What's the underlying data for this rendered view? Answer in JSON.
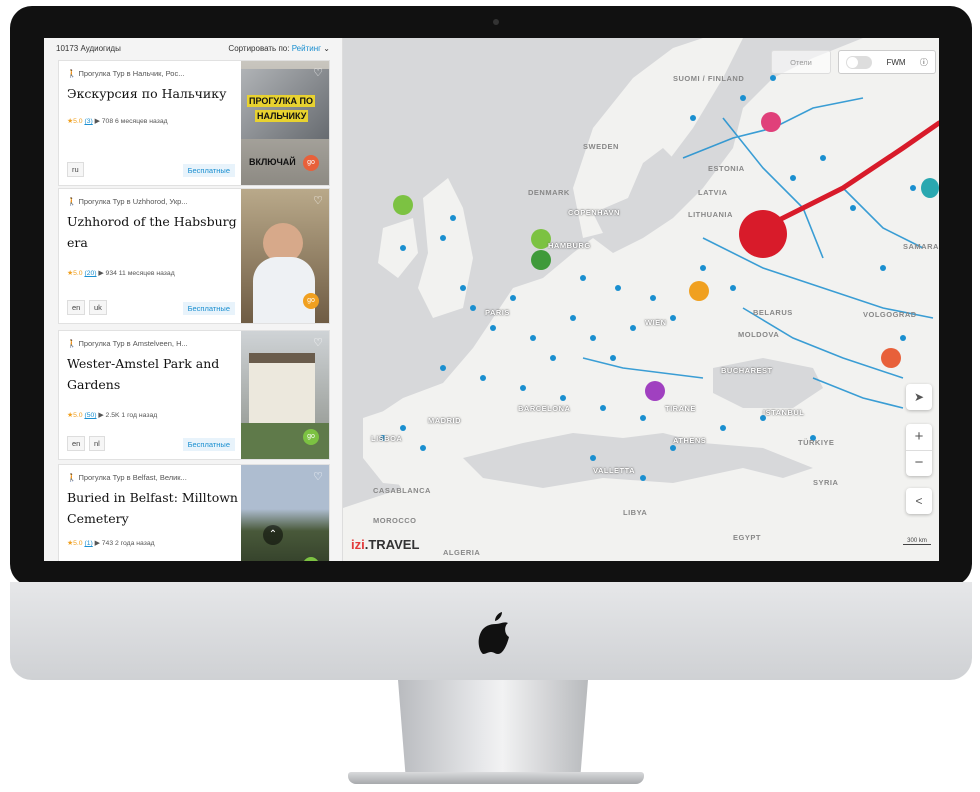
{
  "sidebar": {
    "count_label": "10173 Аудиогиды",
    "sort_label": "Сортировать по:",
    "sort_value": "Рейтинг",
    "cards": [
      {
        "location": "Прогулка Тур в Нальчик, Рос...",
        "title": "Экскурсия по Нальчику",
        "rating": "5.0",
        "reviews": "(3)",
        "plays": "708",
        "age": "6 месяцев назад",
        "langs": [
          "ru"
        ],
        "price": "Бесплатные",
        "img_text_1": "ПРОГУЛКА ПО",
        "img_text_2": "НАЛЬЧИКУ",
        "img_text_3": "ВКЛЮЧАЙ"
      },
      {
        "location": "Прогулка Тур в Uzhhorod, Укр...",
        "title": "Uzhhorod of the Habsburg era",
        "rating": "5.0",
        "reviews": "(20)",
        "plays": "934",
        "age": "11 месяцев назад",
        "langs": [
          "en",
          "uk"
        ],
        "price": "Бесплатные"
      },
      {
        "location": "Прогулка Тур в Amstelveen, H...",
        "title": "Wester-Amstel Park and Gardens",
        "rating": "5.0",
        "reviews": "(50)",
        "plays": "2.5K",
        "age": "1 год назад",
        "langs": [
          "en",
          "nl"
        ],
        "price": "Бесплатные"
      },
      {
        "location": "Прогулка Тур в Belfast, Велик...",
        "title": "Buried in Belfast: Milltown Cemetery",
        "rating": "5.0",
        "reviews": "(1)",
        "plays": "743",
        "age": "2 года назад"
      }
    ]
  },
  "map": {
    "hotels_label": "Отели",
    "fwm_label": "FWM",
    "labels": {
      "sweden": "SWEDEN",
      "finland": "SUOMI / FINLAND",
      "copenhagen": "COPENHAVN",
      "hamburg": "HAMBURG",
      "paris": "PARIS",
      "wien": "WIEN",
      "barcelona": "BARCELONA",
      "madrid": "MADRID",
      "lisboa": "LISBOA",
      "tirane": "TIRANE",
      "athens": "ATHENS",
      "istanbul": "ISTANBUL",
      "bucharest": "BUCHAREST",
      "casablanca": "CASABLANCA",
      "valletta": "VALLETTA",
      "algeria": "ALGERIA",
      "morocco": "MOROCCO",
      "libya": "LIBYA",
      "egypt": "EGYPT",
      "syria": "SYRIA",
      "turkey": "TÜRKIYE",
      "samara": "SAMARA",
      "volgograd": "VOLGOGRAD",
      "moldova": "MOLDOVA",
      "belarus": "BELARUS",
      "latvia": "LATVIA",
      "lithuania": "LITHUANIA",
      "estonia": "ESTONIA",
      "denmark": "DENMARK"
    },
    "scale_label": "300 km",
    "logo_a": "izi",
    "logo_b": ".TRAVEL"
  },
  "colors": {
    "land": "#f2f2f0",
    "sea": "#d7d8da",
    "route": "#1a8fd0",
    "izi_red": "#e23b3b",
    "pin_green": "#7cc242",
    "pin_dark_green": "#3f9a3a",
    "pin_orange": "#f0a020",
    "pin_purple": "#a040c0",
    "pin_red": "#e8603a",
    "pin_teal": "#2aa8b0",
    "pin_pink": "#e0407a",
    "annotation": "#d81b2a"
  }
}
